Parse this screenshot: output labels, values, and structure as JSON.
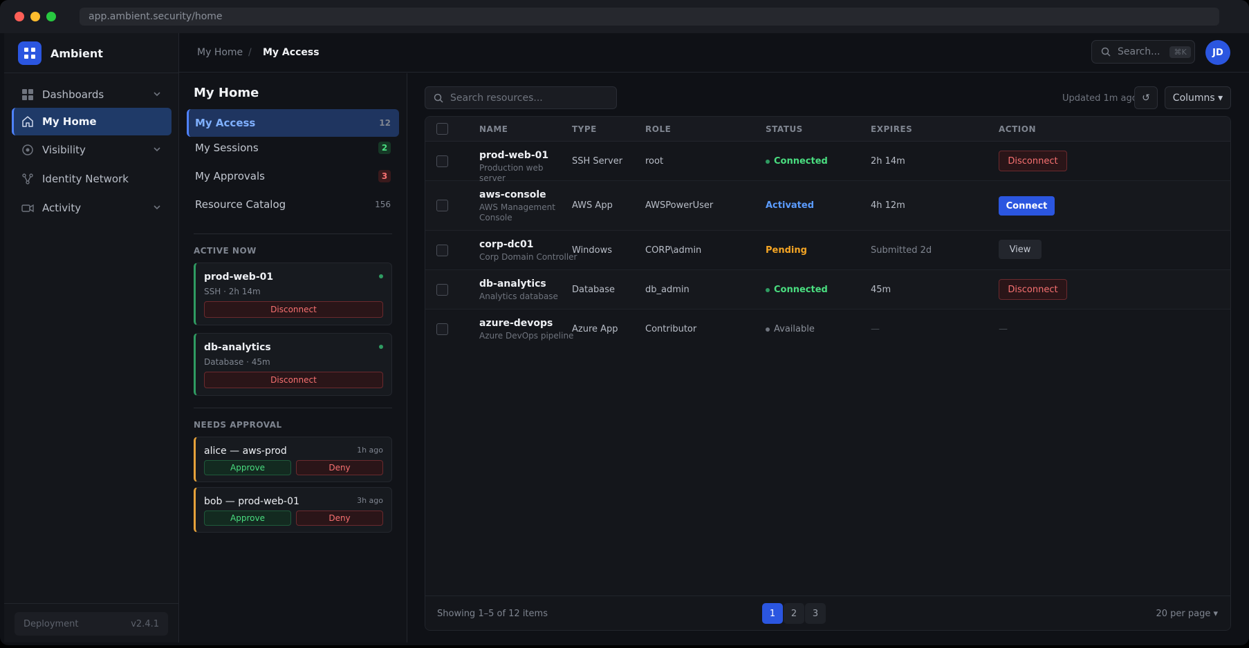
{
  "browser": {
    "url": "app.ambient.security/home"
  },
  "brand": {
    "name": "Ambient"
  },
  "sidebar": {
    "items": [
      {
        "label": "Dashboards",
        "icon": "grid-icon",
        "expandable": true
      },
      {
        "label": "My Home",
        "icon": "home-icon",
        "active": true
      },
      {
        "label": "Visibility",
        "icon": "eye-icon",
        "expandable": true
      },
      {
        "label": "Identity Network",
        "icon": "network-icon"
      },
      {
        "label": "Activity",
        "icon": "video-icon",
        "expandable": true
      }
    ],
    "footer": {
      "label": "Deployment",
      "version": "v2.4.1"
    }
  },
  "header": {
    "breadcrumb": {
      "parent": "My Home",
      "separator": "/",
      "current": "My Access"
    },
    "search": {
      "placeholder": "Search...",
      "shortcut": "⌘K"
    },
    "avatar": "JD"
  },
  "midpanel": {
    "title": "My Home",
    "items": [
      {
        "label": "My Access",
        "count": "12",
        "active": true
      },
      {
        "label": "My Sessions",
        "count": "2",
        "badge": "green"
      },
      {
        "label": "My Approvals",
        "count": "3",
        "badge": "red"
      },
      {
        "label": "Resource Catalog",
        "count": "156"
      }
    ],
    "active_now": {
      "heading": "ACTIVE NOW",
      "cards": [
        {
          "title": "prod-web-01",
          "sub": "SSH · 2h 14m",
          "action": "Disconnect"
        },
        {
          "title": "db-analytics",
          "sub": "Database · 45m",
          "action": "Disconnect"
        }
      ]
    },
    "needs_approval": {
      "heading": "NEEDS APPROVAL",
      "cards": [
        {
          "title": "alice — aws-prod",
          "time": "1h ago",
          "approve": "Approve",
          "deny": "Deny"
        },
        {
          "title": "bob — prod-web-01",
          "time": "3h ago",
          "approve": "Approve",
          "deny": "Deny"
        }
      ]
    }
  },
  "main": {
    "search_placeholder": "Search resources...",
    "updated": "Updated 1m ago",
    "refresh_icon": "↺",
    "columns_label": "Columns ▾",
    "table": {
      "headers": [
        "NAME",
        "TYPE",
        "ROLE",
        "STATUS",
        "EXPIRES",
        "ACTION"
      ],
      "rows": [
        {
          "name": "prod-web-01",
          "desc": "Production web server",
          "type": "SSH Server",
          "role": "root",
          "status": "Connected",
          "status_kind": "connected",
          "expires": "2h 14m",
          "action": "Disconnect",
          "action_kind": "disconnect"
        },
        {
          "name": "aws-console",
          "desc": "AWS Management Console",
          "type": "AWS App",
          "role": "AWSPowerUser",
          "status": "Activated",
          "status_kind": "activated",
          "expires": "4h 12m",
          "action": "Connect",
          "action_kind": "connect"
        },
        {
          "name": "corp-dc01",
          "desc": "Corp Domain Controller",
          "type": "Windows",
          "role": "CORP\\admin",
          "status": "Pending",
          "status_kind": "pending",
          "expires": "Submitted 2d",
          "action": "View",
          "action_kind": "view"
        },
        {
          "name": "db-analytics",
          "desc": "Analytics database",
          "type": "Database",
          "role": "db_admin",
          "status": "Connected",
          "status_kind": "connected",
          "expires": "45m",
          "action": "Disconnect",
          "action_kind": "disconnect"
        },
        {
          "name": "azure-devops",
          "desc": "Azure DevOps pipeline",
          "type": "Azure App",
          "role": "Contributor",
          "status": "Available",
          "status_kind": "available",
          "expires": "—",
          "action": "—",
          "action_kind": "none"
        }
      ]
    },
    "footer": {
      "showing": "Showing 1–5 of 12 items",
      "pages": [
        "1",
        "2",
        "3"
      ],
      "current_page": "1",
      "per_page": "20 per page ▾"
    }
  },
  "colors": {
    "accent": "#2b56e0",
    "connected": "#4ade80",
    "activated": "#5b9cff",
    "pending": "#f5a524",
    "danger": "#f87171",
    "muted": "#7f8590"
  }
}
